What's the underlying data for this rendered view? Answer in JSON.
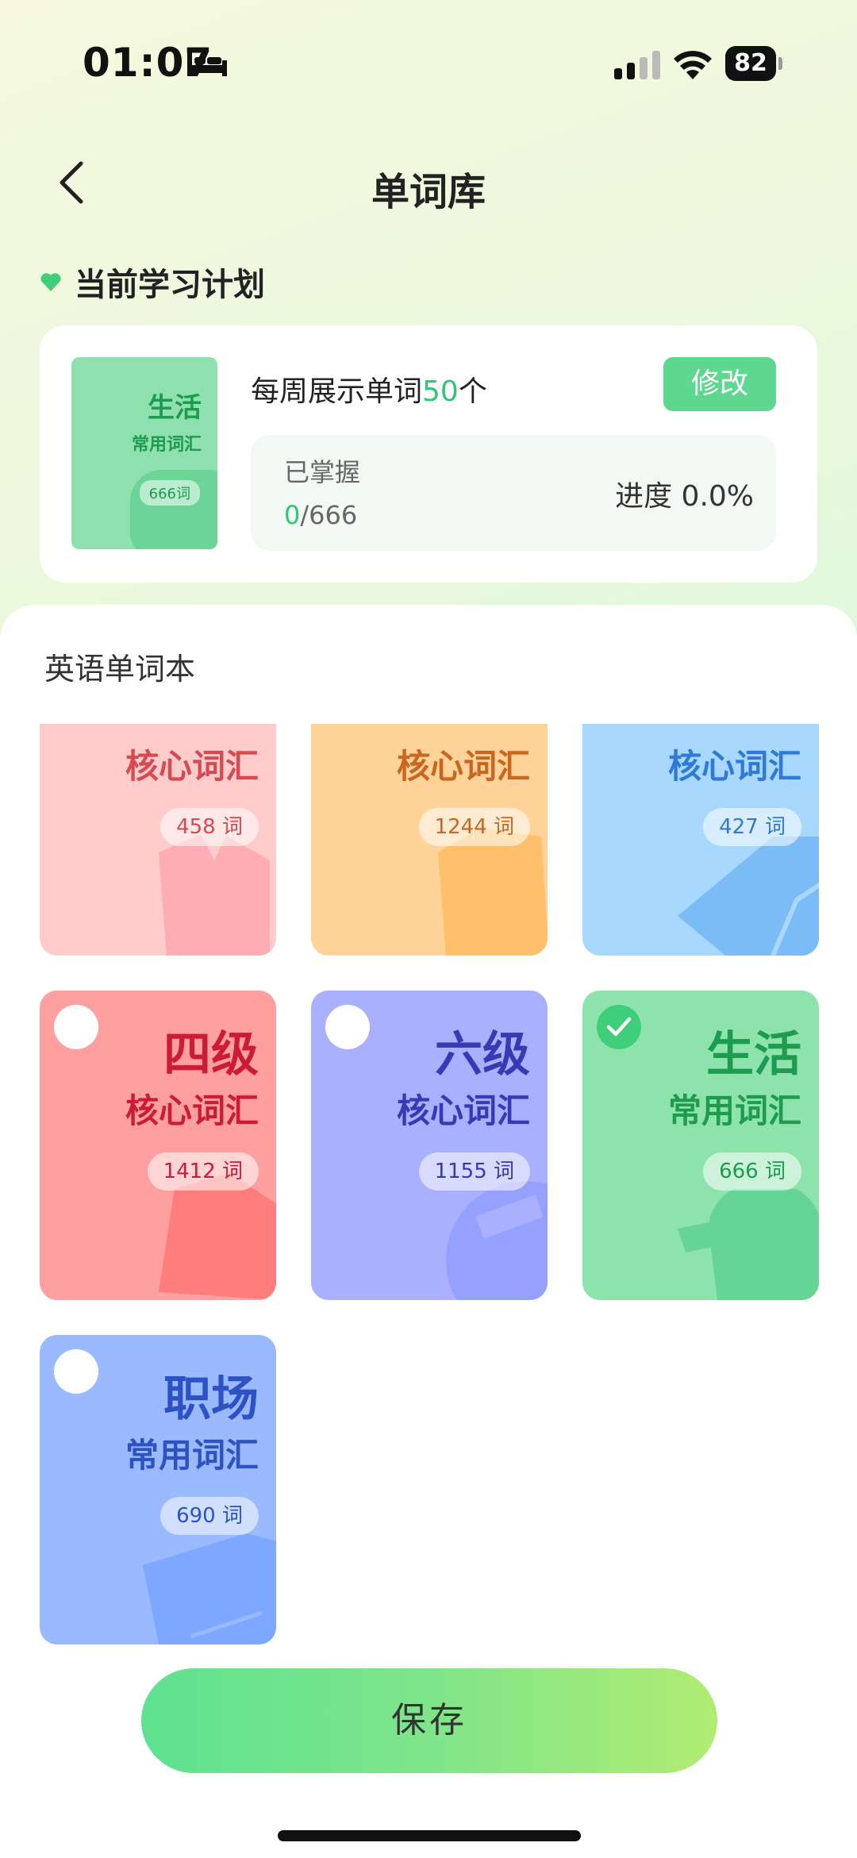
{
  "status_bar": {
    "time": "01:07",
    "battery": "82"
  },
  "nav": {
    "title": "单词库"
  },
  "plan": {
    "heading": "当前学习计划",
    "book_title": "生活",
    "book_subtitle": "常用词汇",
    "book_count": "666词",
    "weekly_prefix": "每周展示单词",
    "weekly_number": "50",
    "weekly_suffix": "个",
    "edit_label": "修改",
    "mastered_label": "已掌握",
    "mastered_done": "0",
    "mastered_total": "/666",
    "progress_text": "进度 0.0%"
  },
  "sheet": {
    "title": "英语单词本",
    "books": [
      {
        "title": "",
        "subtitle": "核心词汇",
        "count": "458 词",
        "selected": null
      },
      {
        "title": "",
        "subtitle": "核心词汇",
        "count": "1244 词",
        "selected": null
      },
      {
        "title": "",
        "subtitle": "核心词汇",
        "count": "427 词",
        "selected": null
      },
      {
        "title": "四级",
        "subtitle": "核心词汇",
        "count": "1412 词",
        "selected": false
      },
      {
        "title": "六级",
        "subtitle": "核心词汇",
        "count": "1155 词",
        "selected": false
      },
      {
        "title": "生活",
        "subtitle": "常用词汇",
        "count": "666 词",
        "selected": true
      },
      {
        "title": "职场",
        "subtitle": "常用词汇",
        "count": "690 词",
        "selected": false
      }
    ]
  },
  "save_label": "保存",
  "colors": {
    "accent_green": "#2fc774",
    "edit_button": "#5fd88f"
  }
}
